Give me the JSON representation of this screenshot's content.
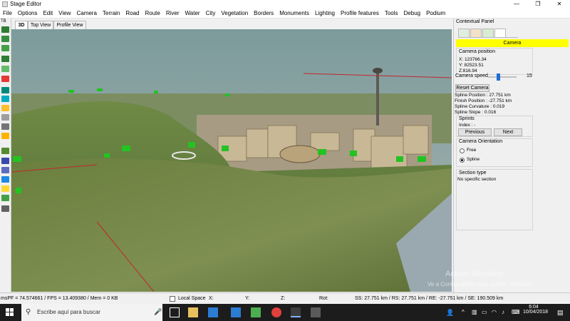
{
  "window": {
    "title": "Stage Editor",
    "minimize": "—",
    "maximize": "❐",
    "close": "✕"
  },
  "menu": [
    "File",
    "Options",
    "Edit",
    "View",
    "Camera",
    "Terrain",
    "Road",
    "Route",
    "River",
    "Water",
    "City",
    "Vegetation",
    "Borders",
    "Monuments",
    "Lighting",
    "Profile features",
    "Tools",
    "Debug",
    "Podium"
  ],
  "lefttools_label": "TB",
  "tabs": [
    "3D",
    "Top View",
    "Profile View"
  ],
  "panel": {
    "title": "Contextual Panel",
    "section_title": "Camera",
    "camera_position_label": "Camera position",
    "x": "X: 123766.34",
    "y": "Y: 82523.51",
    "z": "Z:816.94",
    "camera_speed_label": "Camera speed",
    "camera_speed_value": "15",
    "camera_speed_fraction": 0.35,
    "reset_camera": "Reset Camera",
    "spline_position": "Spline Position : 27.751 km",
    "finish_position": "Finish Position : -27.751 km",
    "spline_curvature": "Spline Curvature : 0.019",
    "spline_slope": "Spline Slope : 0.016",
    "sprints_label": "Sprints",
    "index_label": "Index : -",
    "previous": "Previous",
    "next": "Next",
    "orientation_label": "Camera Orientation",
    "free": "Free",
    "spline": "Spline",
    "section_type_label": "Section type",
    "section_type_value": "No specific section",
    "accent_color": "#ffff00"
  },
  "status": {
    "perf": "msPF = 74.574661 / FPS = 13.409380 / Mem = 0 KB",
    "local_space": "Local Space",
    "x_label": "X:",
    "y_label": "Y:",
    "z_label": "Z:",
    "rot_label": "Rot:",
    "distances": "SS: 27.751 km / RS: 27.751 km / RE: -27.751 km / SE: 190.509 km"
  },
  "watermark": {
    "line1": "Activar Windows",
    "line2": "Ve a Configuración para activar Windows."
  },
  "taskbar": {
    "search_placeholder": "Escribe aquí para buscar",
    "time": "6:04",
    "date": "10/04/2018"
  }
}
